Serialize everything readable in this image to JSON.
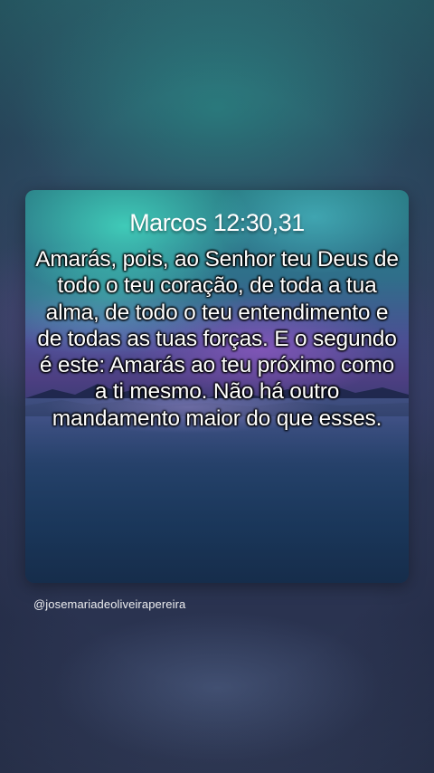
{
  "card": {
    "reference": "Marcos 12:30,31",
    "verse": "Amarás, pois, ao Senhor teu Deus de todo o teu coração, de toda a tua alma, de todo o teu entendimento e de todas as tuas forças. E o segundo é este: Amarás ao teu próximo como a ti mesmo. Não há outro mandamento maior do que esses."
  },
  "post": {
    "username": "@josemariadeoliveirapereira"
  },
  "colors": {
    "text": "#ffffff",
    "background_top": "#2f6f78",
    "background_bottom": "#313b58",
    "card_aurora": "#46e6c8",
    "card_night": "#1b2d4e"
  }
}
